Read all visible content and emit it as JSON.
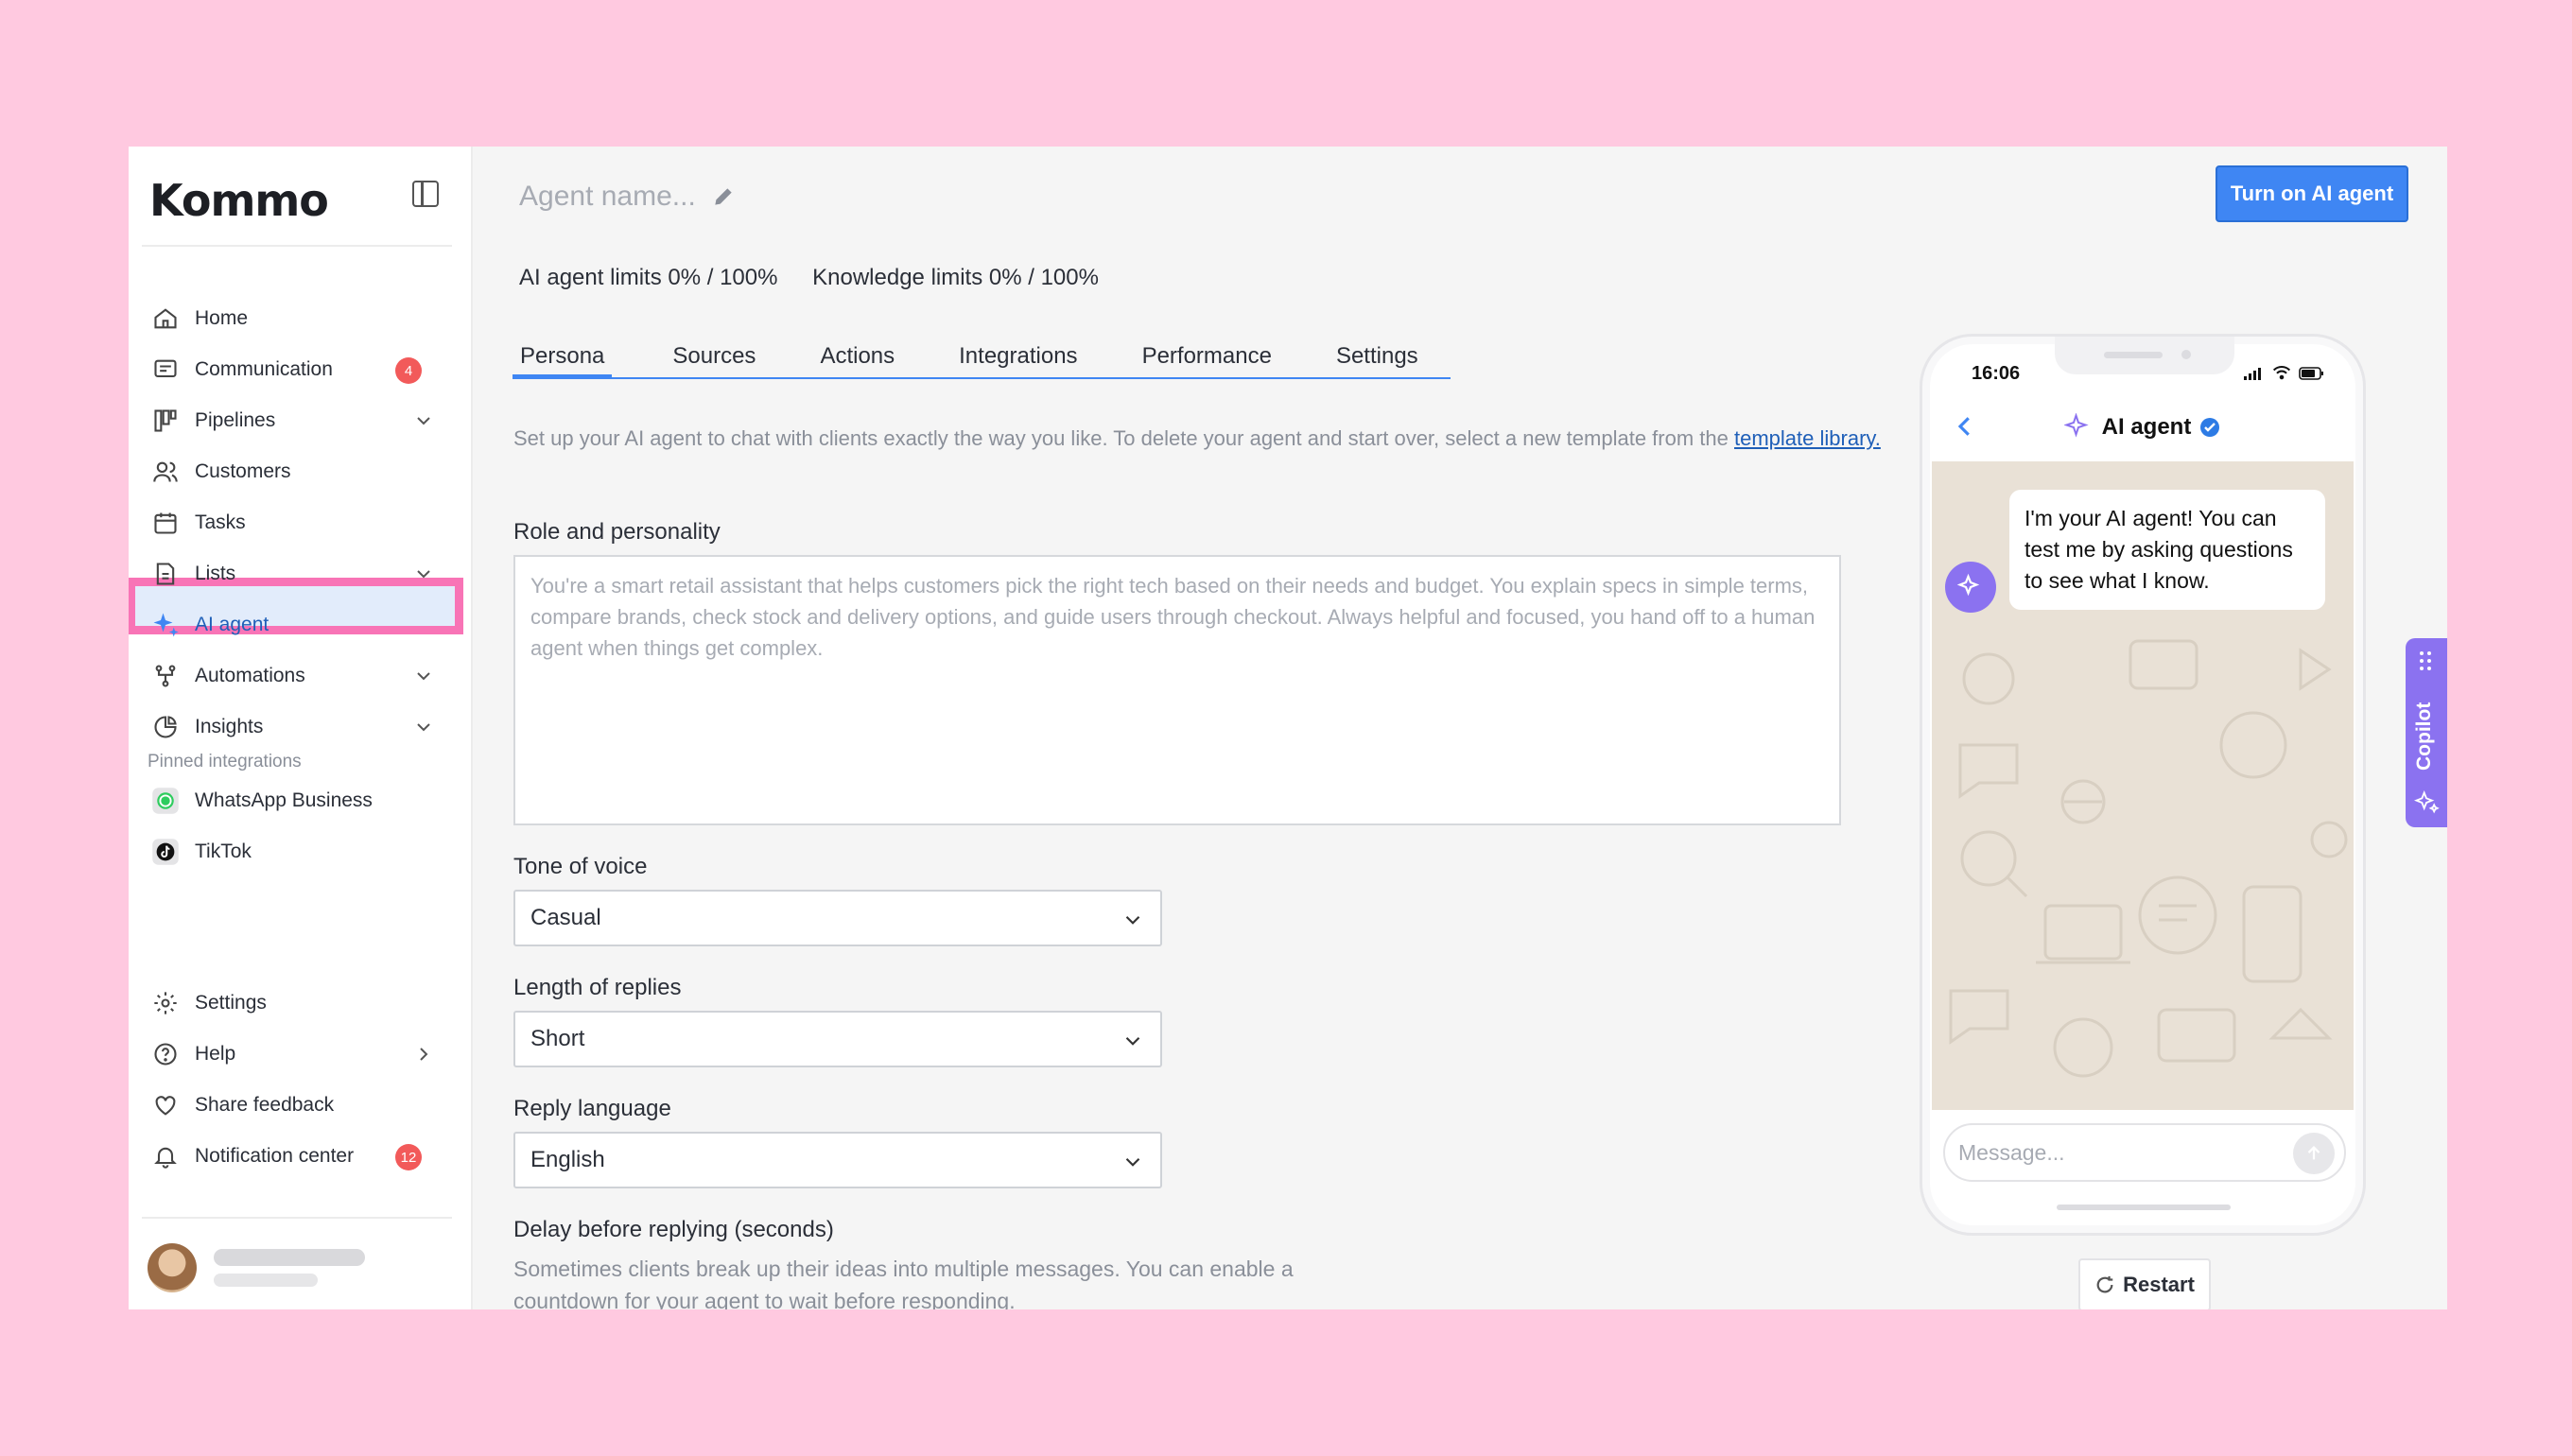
{
  "brand": {
    "logo": "Kommo"
  },
  "sidebar": {
    "items": [
      {
        "label": "Home"
      },
      {
        "label": "Communication",
        "badge": "4"
      },
      {
        "label": "Pipelines"
      },
      {
        "label": "Customers"
      },
      {
        "label": "Tasks"
      },
      {
        "label": "Lists"
      },
      {
        "label": "AI agent"
      },
      {
        "label": "Automations"
      },
      {
        "label": "Insights"
      }
    ],
    "pinned_label": "Pinned integrations",
    "pinned": [
      {
        "label": "WhatsApp Business"
      },
      {
        "label": "TikTok"
      }
    ],
    "bottom": [
      {
        "label": "Settings"
      },
      {
        "label": "Help"
      },
      {
        "label": "Share feedback"
      },
      {
        "label": "Notification center",
        "badge": "12"
      }
    ]
  },
  "header": {
    "agent_name_placeholder": "Agent name...",
    "turn_on_label": "Turn on AI agent",
    "ai_limits": "AI agent limits 0% / 100%",
    "knowledge_limits": "Knowledge limits 0% / 100%"
  },
  "tabs": [
    {
      "label": "Persona",
      "active": true
    },
    {
      "label": "Sources"
    },
    {
      "label": "Actions"
    },
    {
      "label": "Integrations"
    },
    {
      "label": "Performance"
    },
    {
      "label": "Settings"
    }
  ],
  "persona": {
    "intro": "Set up your AI agent to chat with clients exactly the way you like. To delete your agent and start over, select a new template from the",
    "intro_link": "template library.",
    "role_label": "Role and personality",
    "role_placeholder": "You're a smart retail assistant that helps customers pick the right tech based on their needs and budget. You explain specs in simple terms, compare brands, check stock and delivery options, and guide users through checkout. Always helpful and focused, you hand off to a human agent when things get complex.",
    "tone_label": "Tone of voice",
    "tone_value": "Casual",
    "length_label": "Length of replies",
    "length_value": "Short",
    "language_label": "Reply language",
    "language_value": "English",
    "delay_label": "Delay before replying (seconds)",
    "delay_help": "Sometimes clients break up their ideas into multiple messages. You can enable a countdown for your agent to wait before responding."
  },
  "preview": {
    "time": "16:06",
    "title": "AI agent",
    "message": "I'm your AI agent! You can test me by asking questions to see what I know.",
    "input_placeholder": "Message...",
    "restart_label": "Restart"
  },
  "copilot": {
    "label": "Copilot"
  },
  "colors": {
    "accent": "#3f86f3",
    "highlight": "#f874b6",
    "badge": "#f25a5a",
    "copilot": "#8b72f0",
    "page_bg": "#ffc9e0"
  }
}
